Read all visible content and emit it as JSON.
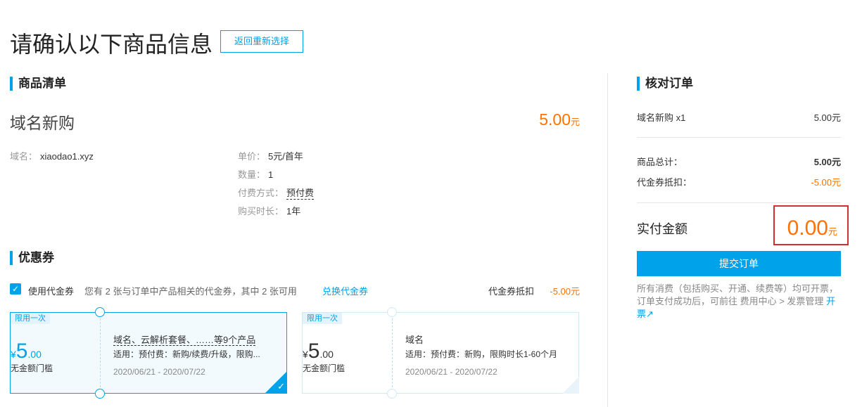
{
  "page_title": "请确认以下商品信息",
  "back_button": "返回重新选择",
  "goods_list": {
    "title": "商品清单",
    "product_name": "域名新购",
    "price": "5.00",
    "price_unit": "元",
    "domain_label": "域名：",
    "domain_value": "xiaodao1.xyz",
    "unit_price_label": "单价：",
    "unit_price_value": "5元/首年",
    "quantity_label": "数量：",
    "quantity_value": "1",
    "payment_label": "付费方式：",
    "payment_value": "预付费",
    "duration_label": "购买时长：",
    "duration_value": "1年"
  },
  "coupons": {
    "title": "优惠券",
    "use_label": "使用代金券",
    "info": "您有 2 张与订单中产品相关的代金券，其中 2 张可用",
    "exchange_link": "兑换代金券",
    "deduct_label": "代金券抵扣",
    "deduct_value": "-5.00元",
    "cards": [
      {
        "tag": "限用一次",
        "currency": "¥",
        "amount_int": "5",
        "amount_dec": ".00",
        "threshold": "无金额门槛",
        "scope": "域名、云解析套餐、……等9个产品",
        "usage": "适用：预付费：新购/续费/升级，限购...",
        "date": "2020/06/21 - 2020/07/22",
        "selected": true
      },
      {
        "tag": "限用一次",
        "currency": "¥",
        "amount_int": "5",
        "amount_dec": ".00",
        "threshold": "无金额门槛",
        "scope": "域名",
        "usage": "适用：预付费：新购，限购时长1-60个月",
        "date": "2020/06/21 - 2020/07/22",
        "selected": false
      }
    ]
  },
  "order_review": {
    "title": "核对订单",
    "item_label": "域名新购 x1",
    "item_value": "5.00元",
    "total_label": "商品总计：",
    "total_value": "5.00元",
    "voucher_label": "代金券抵扣：",
    "voucher_value": "-5.00元",
    "pay_label": "实付金额",
    "pay_value": "0.00",
    "pay_unit": "元",
    "submit_button": "提交订单",
    "note": "所有消费（包括购买、开通、续费等）均可开票，订单支付成功后，可前往 费用中心 > 发票管理",
    "invoice_link": "开票"
  },
  "colors": {
    "accent": "#00a2ea",
    "price": "#ff7200",
    "highlight_border": "#d32f2f"
  }
}
